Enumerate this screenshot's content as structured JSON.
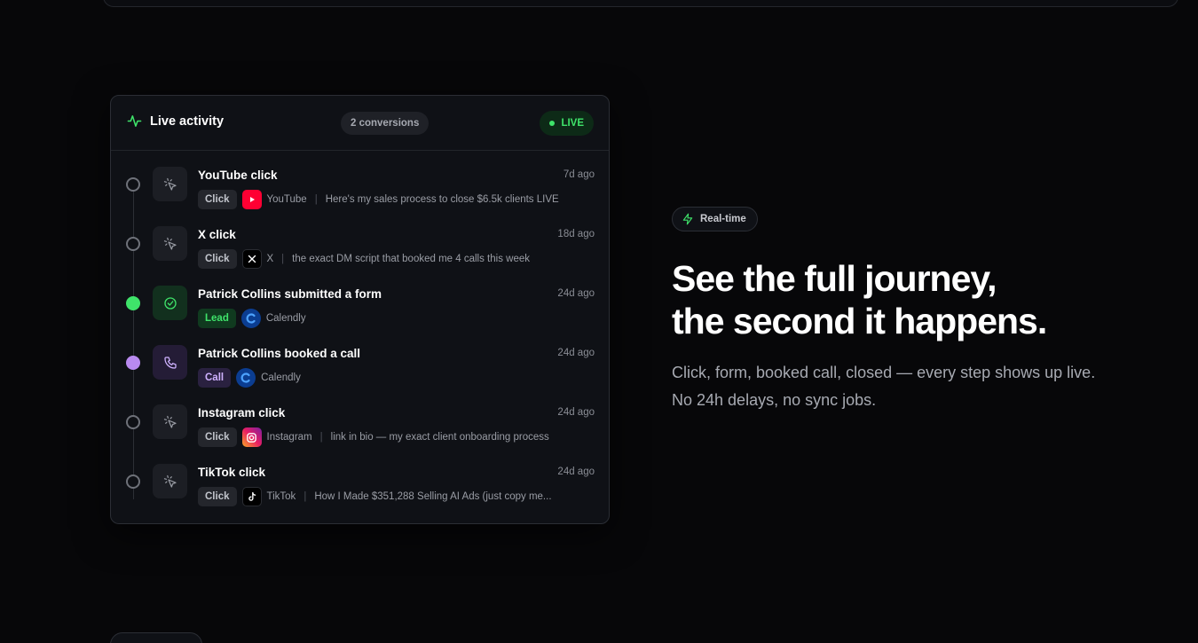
{
  "activity": {
    "title": "Live activity",
    "conversions": "2 conversions",
    "live": "LIVE",
    "items": [
      {
        "title": "YouTube click",
        "time": "7d ago",
        "tag": "Click",
        "platform": "YouTube",
        "detail": "Here's my sales process to close $6.5k clients LIVE"
      },
      {
        "title": "X click",
        "time": "18d ago",
        "tag": "Click",
        "platform": "X",
        "detail": "the exact DM script that booked me 4 calls this week"
      },
      {
        "title": "Patrick Collins submitted a form",
        "time": "24d ago",
        "tag": "Lead",
        "platform": "Calendly"
      },
      {
        "title": "Patrick Collins booked a call",
        "time": "24d ago",
        "tag": "Call",
        "platform": "Calendly"
      },
      {
        "title": "Instagram click",
        "time": "24d ago",
        "tag": "Click",
        "platform": "Instagram",
        "detail": "link in bio — my exact client onboarding process"
      },
      {
        "title": "TikTok click",
        "time": "24d ago",
        "tag": "Click",
        "platform": "TikTok",
        "detail": "How I Made $351,288 Selling AI Ads (just copy me..."
      }
    ]
  },
  "hero": {
    "badge": "Real-time",
    "headline_line1": "See the full journey,",
    "headline_line2": "the second it happens.",
    "subtext": "Click, form, booked call, closed — every step shows up live. No 24h delays, no sync jobs."
  },
  "colors": {
    "accent_green": "#3fe36a",
    "accent_purple": "#b98af0",
    "background": "#070709"
  }
}
